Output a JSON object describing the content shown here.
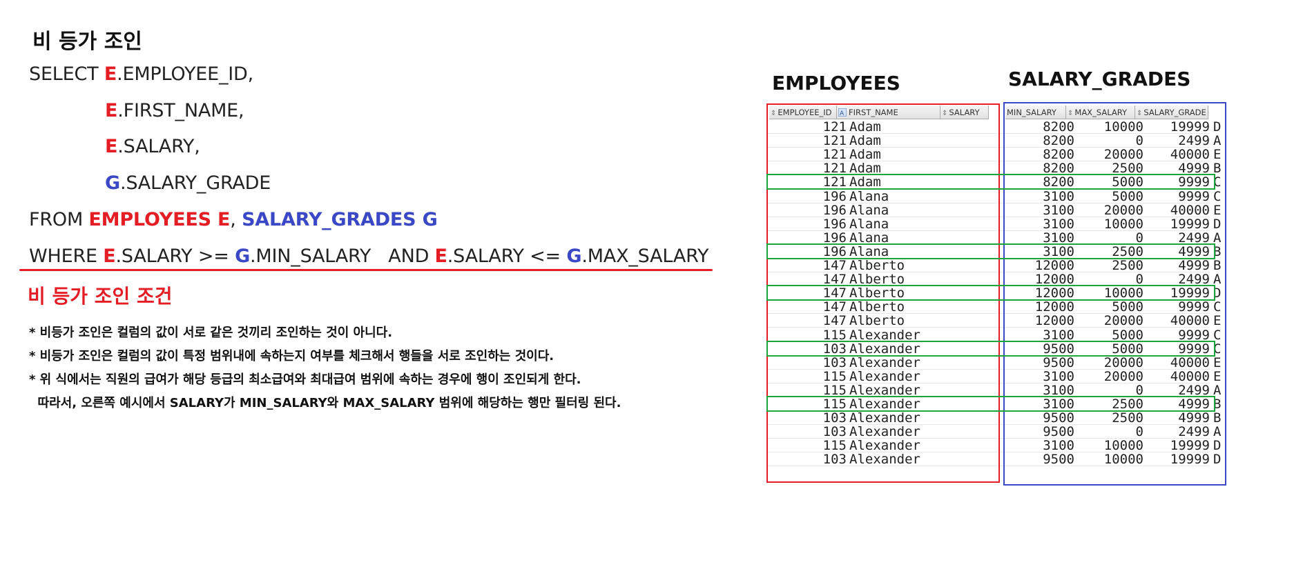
{
  "title": "비 등가 조인",
  "sql": {
    "select_kw": "SELECT ",
    "line1_alias": "E",
    "line1_col": ".EMPLOYEE_ID,",
    "line2_alias": "E",
    "line2_col": ".FIRST_NAME,",
    "line3_alias": "E",
    "line3_col": ".SALARY,",
    "line4_alias": "G",
    "line4_col": ".SALARY_GRADE",
    "from_kw": "FROM ",
    "from_t1": "EMPLOYEES E",
    "from_comma": ", ",
    "from_t2": "SALARY_GRADES G",
    "where_kw": "WHERE ",
    "w_a1": "E",
    "w_c1": ".SALARY >= ",
    "w_a2": "G",
    "w_c2": ".MIN_SALARY   AND ",
    "w_a3": "E",
    "w_c3": ".SALARY <= ",
    "w_a4": "G",
    "w_c4": ".MAX_SALARY"
  },
  "condition_label": "비 등가 조인 조건",
  "notes": [
    "* 비등가 조인은 컬럼의 값이 서로 같은 것끼리 조인하는 것이 아니다.",
    "* 비등가 조인은 컬럼의 값이 특정 범위내에 속하는지 여부를 체크해서 행들을 서로 조인하는 것이다.",
    "* 위 식에서는 직원의 급여가 해당 등급의 최소급여와 최대급여 범위에 속하는 경우에 행이 조인되게 한다.",
    "  따라서, 오른쪽 예시에서 SALARY가 MIN_SALARY와 MAX_SALARY 범위에 해당하는 행만 필터링 된다."
  ],
  "employees_title": "EMPLOYEES",
  "salary_grades_title": "SALARY_GRADES",
  "columns": [
    "EMPLOYEE_ID",
    "FIRST_NAME",
    "SALARY",
    "MIN_SALARY",
    "MAX_SALARY",
    "SALARY_GRADE"
  ],
  "rows": [
    {
      "id": "121",
      "fn": "Adam",
      "sal": "8200",
      "min": "10000",
      "max": "19999",
      "grd": "D",
      "hl": false
    },
    {
      "id": "121",
      "fn": "Adam",
      "sal": "8200",
      "min": "0",
      "max": "2499",
      "grd": "A",
      "hl": false
    },
    {
      "id": "121",
      "fn": "Adam",
      "sal": "8200",
      "min": "20000",
      "max": "40000",
      "grd": "E",
      "hl": false
    },
    {
      "id": "121",
      "fn": "Adam",
      "sal": "8200",
      "min": "2500",
      "max": "4999",
      "grd": "B",
      "hl": false
    },
    {
      "id": "121",
      "fn": "Adam",
      "sal": "8200",
      "min": "5000",
      "max": "9999",
      "grd": "C",
      "hl": true
    },
    {
      "id": "196",
      "fn": "Alana",
      "sal": "3100",
      "min": "5000",
      "max": "9999",
      "grd": "C",
      "hl": false
    },
    {
      "id": "196",
      "fn": "Alana",
      "sal": "3100",
      "min": "20000",
      "max": "40000",
      "grd": "E",
      "hl": false
    },
    {
      "id": "196",
      "fn": "Alana",
      "sal": "3100",
      "min": "10000",
      "max": "19999",
      "grd": "D",
      "hl": false
    },
    {
      "id": "196",
      "fn": "Alana",
      "sal": "3100",
      "min": "0",
      "max": "2499",
      "grd": "A",
      "hl": false
    },
    {
      "id": "196",
      "fn": "Alana",
      "sal": "3100",
      "min": "2500",
      "max": "4999",
      "grd": "B",
      "hl": true
    },
    {
      "id": "147",
      "fn": "Alberto",
      "sal": "12000",
      "min": "2500",
      "max": "4999",
      "grd": "B",
      "hl": false
    },
    {
      "id": "147",
      "fn": "Alberto",
      "sal": "12000",
      "min": "0",
      "max": "2499",
      "grd": "A",
      "hl": false
    },
    {
      "id": "147",
      "fn": "Alberto",
      "sal": "12000",
      "min": "10000",
      "max": "19999",
      "grd": "D",
      "hl": true
    },
    {
      "id": "147",
      "fn": "Alberto",
      "sal": "12000",
      "min": "5000",
      "max": "9999",
      "grd": "C",
      "hl": false
    },
    {
      "id": "147",
      "fn": "Alberto",
      "sal": "12000",
      "min": "20000",
      "max": "40000",
      "grd": "E",
      "hl": false
    },
    {
      "id": "115",
      "fn": "Alexander",
      "sal": "3100",
      "min": "5000",
      "max": "9999",
      "grd": "C",
      "hl": false
    },
    {
      "id": "103",
      "fn": "Alexander",
      "sal": "9500",
      "min": "5000",
      "max": "9999",
      "grd": "C",
      "hl": true
    },
    {
      "id": "103",
      "fn": "Alexander",
      "sal": "9500",
      "min": "20000",
      "max": "40000",
      "grd": "E",
      "hl": false
    },
    {
      "id": "115",
      "fn": "Alexander",
      "sal": "3100",
      "min": "20000",
      "max": "40000",
      "grd": "E",
      "hl": false
    },
    {
      "id": "115",
      "fn": "Alexander",
      "sal": "3100",
      "min": "0",
      "max": "2499",
      "grd": "A",
      "hl": false
    },
    {
      "id": "115",
      "fn": "Alexander",
      "sal": "3100",
      "min": "2500",
      "max": "4999",
      "grd": "B",
      "hl": true
    },
    {
      "id": "103",
      "fn": "Alexander",
      "sal": "9500",
      "min": "2500",
      "max": "4999",
      "grd": "B",
      "hl": false
    },
    {
      "id": "103",
      "fn": "Alexander",
      "sal": "9500",
      "min": "0",
      "max": "2499",
      "grd": "A",
      "hl": false
    },
    {
      "id": "115",
      "fn": "Alexander",
      "sal": "3100",
      "min": "10000",
      "max": "19999",
      "grd": "D",
      "hl": false
    },
    {
      "id": "103",
      "fn": "Alexander",
      "sal": "9500",
      "min": "10000",
      "max": "19999",
      "grd": "D",
      "hl": false
    }
  ],
  "colors": {
    "red": "#e41d25",
    "blue": "#3b48c6",
    "green": "#1aa63a"
  }
}
